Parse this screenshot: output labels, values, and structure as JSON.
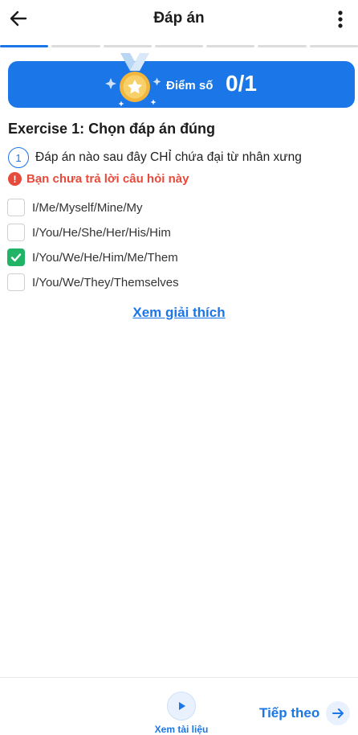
{
  "header": {
    "title": "Đáp án",
    "back_icon": "arrow-left-icon",
    "menu_icon": "more-vertical-icon"
  },
  "progress": {
    "total_segments": 7,
    "current_segment": 1
  },
  "score": {
    "label": "Điểm số",
    "value": "0/1",
    "medal_icon": "medal-icon"
  },
  "exercise": {
    "title": "Exercise 1: Chọn đáp án đúng",
    "question_number": "1",
    "question_text": "Đáp án nào sau đây CHỈ chứa đại từ nhân xưng",
    "warning_text": "Bạn chưa trả lời câu hỏi này",
    "options": [
      {
        "label": "I/Me/Myself/Mine/My",
        "checked": false
      },
      {
        "label": "I/You/He/She/Her/His/Him",
        "checked": false
      },
      {
        "label": "I/You/We/He/Him/Me/Them",
        "checked": true
      },
      {
        "label": "I/You/We/They/Themselves",
        "checked": false
      }
    ],
    "explain_link": "Xem giải thích"
  },
  "bottom_bar": {
    "material_label": "Xem tài liệu",
    "next_label": "Tiếp theo"
  },
  "colors": {
    "accent": "#1b76e8",
    "correct": "#21b466",
    "warning": "#e64a3b"
  }
}
